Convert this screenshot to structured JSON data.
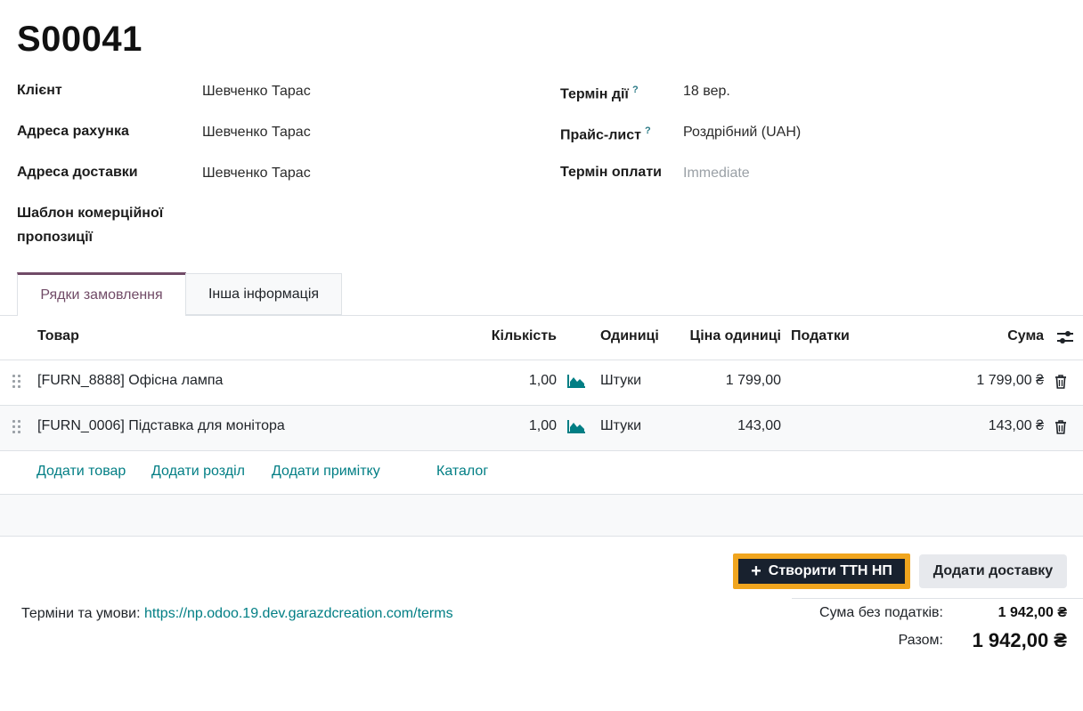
{
  "order": {
    "name": "S00041"
  },
  "left_fields": [
    {
      "label": "Клієнт",
      "value": "Шевченко Тарас"
    },
    {
      "label": "Адреса рахунка",
      "value": "Шевченко Тарас"
    },
    {
      "label": "Адреса доставки",
      "value": "Шевченко Тарас"
    },
    {
      "label_line1": "Шаблон комерційної",
      "label_line2": "пропозиції",
      "value": ""
    }
  ],
  "right_fields": [
    {
      "label": "Термін дії",
      "help": "?",
      "value": "18 вер."
    },
    {
      "label": "Прайс-лист",
      "help": "?",
      "value": "Роздрібний (UAH)"
    },
    {
      "label": "Термін оплати",
      "value": "Immediate"
    }
  ],
  "tabs": [
    {
      "label": "Рядки замовлення",
      "active": true
    },
    {
      "label": "Інша інформація",
      "active": false
    }
  ],
  "table": {
    "columns": {
      "product": "Товар",
      "qty": "Кількість",
      "uom": "Одиниці",
      "price": "Ціна одиниці",
      "taxes": "Податки",
      "subtotal": "Сума"
    },
    "rows": [
      {
        "product": "[FURN_8888] Офісна лампа",
        "qty": "1,00",
        "uom": "Штуки",
        "price": "1 799,00",
        "taxes": "",
        "subtotal": "1 799,00 ₴"
      },
      {
        "product": "[FURN_0006] Підставка для монітора",
        "qty": "1,00",
        "uom": "Штуки",
        "price": "143,00",
        "taxes": "",
        "subtotal": "143,00 ₴"
      }
    ]
  },
  "line_actions": {
    "add_product": "Додати товар",
    "add_section": "Додати розділ",
    "add_note": "Додати примітку",
    "catalog": "Каталог"
  },
  "buttons": {
    "create_ttn": "Створити ТТН НП",
    "add_delivery": "Додати доставку"
  },
  "terms": {
    "label": "Терміни та умови:",
    "url": "https://np.odoo.19.dev.garazdcreation.com/terms"
  },
  "totals": {
    "untaxed_label": "Сума без податків:",
    "untaxed_value": "1 942,00 ₴",
    "total_label": "Разом:",
    "total_value": "1 942,00 ₴"
  },
  "colors": {
    "accent": "#714b67",
    "link": "#017e84",
    "highlight": "#f0a51e",
    "dark_button": "#18212e"
  },
  "icons": [
    "forecast-chart-icon",
    "trash-icon",
    "drag-handle-icon",
    "column-settings-icon",
    "plus-icon"
  ]
}
